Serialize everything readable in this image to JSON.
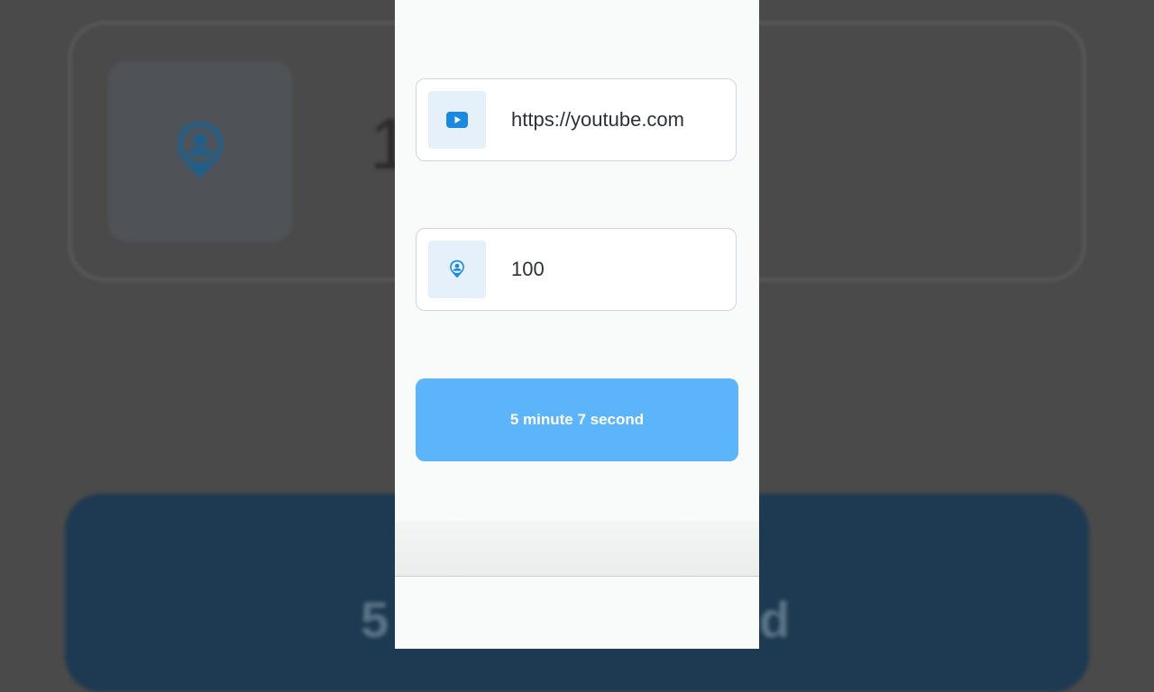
{
  "background": {
    "number_fragment": "1",
    "button_fragment_left": "5",
    "button_fragment_right": "d"
  },
  "form": {
    "url_field": {
      "icon": "youtube-play-icon",
      "value": "https://youtube.com"
    },
    "count_field": {
      "icon": "person-pin-icon",
      "value": "100"
    },
    "action_button": {
      "label": "5 minute 7 second"
    }
  },
  "colors": {
    "accent": "#5cb5fb",
    "icon_blue": "#1a8ae0",
    "icon_box": "#e6f0fa"
  }
}
